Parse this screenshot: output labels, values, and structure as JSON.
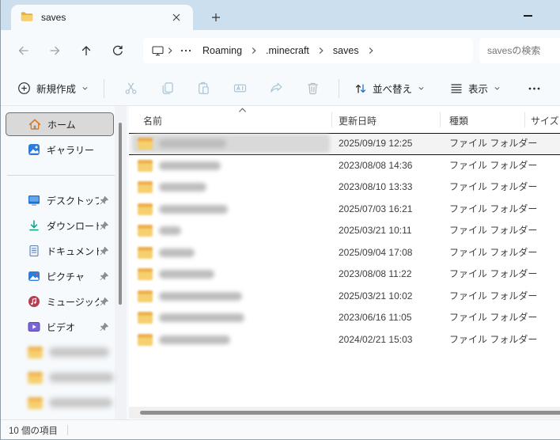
{
  "titlebar": {
    "tab_title": "saves"
  },
  "address": {
    "crumbs": [
      "Roaming",
      ".minecraft",
      "saves"
    ],
    "device_icon": "this-pc-icon"
  },
  "search": {
    "placeholder": "savesの検索"
  },
  "toolbar": {
    "new_label": "新規作成",
    "sort_label": "並べ替え",
    "view_label": "表示",
    "disabled_icons": [
      "cut",
      "copy",
      "paste",
      "rename",
      "share",
      "delete"
    ]
  },
  "sidebar": {
    "items": [
      {
        "label": "ホーム",
        "icon": "home",
        "selected": true,
        "pinned": false
      },
      {
        "label": "ギャラリー",
        "icon": "gallery",
        "selected": false,
        "pinned": false
      },
      {
        "divider": true
      },
      {
        "label": "デスクトップ",
        "icon": "desktop",
        "selected": false,
        "pinned": true
      },
      {
        "label": "ダウンロード",
        "icon": "downloads",
        "selected": false,
        "pinned": true
      },
      {
        "label": "ドキュメント",
        "icon": "documents",
        "selected": false,
        "pinned": true
      },
      {
        "label": "ピクチャ",
        "icon": "pictures",
        "selected": false,
        "pinned": true
      },
      {
        "label": "ミュージック",
        "icon": "music",
        "selected": false,
        "pinned": true
      },
      {
        "label": "ビデオ",
        "icon": "videos",
        "selected": false,
        "pinned": true
      },
      {
        "blurred": true,
        "blur_width": 76
      },
      {
        "blurred": true,
        "blur_width": 86
      },
      {
        "blurred": true,
        "blur_width": 80
      }
    ]
  },
  "list": {
    "columns": [
      "名前",
      "更新日時",
      "種類",
      "サイズ"
    ],
    "sort": {
      "column": "名前",
      "direction": "asc"
    },
    "rows": [
      {
        "name_blurred": true,
        "blur_width": 85,
        "date": "2025/09/19 12:25",
        "type": "ファイル フォルダー",
        "selected": true
      },
      {
        "name_blurred": true,
        "blur_width": 78,
        "date": "2023/08/08 14:36",
        "type": "ファイル フォルダー",
        "selected": false
      },
      {
        "name_blurred": true,
        "blur_width": 60,
        "date": "2023/08/10 13:33",
        "type": "ファイル フォルダー",
        "selected": false
      },
      {
        "name_blurred": true,
        "blur_width": 87,
        "date": "2025/07/03 16:21",
        "type": "ファイル フォルダー",
        "selected": false
      },
      {
        "name_blurred": true,
        "blur_width": 28,
        "date": "2025/03/21 10:11",
        "type": "ファイル フォルダー",
        "selected": false
      },
      {
        "name_blurred": true,
        "blur_width": 45,
        "date": "2025/09/04 17:08",
        "type": "ファイル フォルダー",
        "selected": false
      },
      {
        "name_blurred": true,
        "blur_width": 70,
        "date": "2023/08/08 11:22",
        "type": "ファイル フォルダー",
        "selected": false
      },
      {
        "name_blurred": true,
        "blur_width": 105,
        "date": "2025/03/21 10:02",
        "type": "ファイル フォルダー",
        "selected": false
      },
      {
        "name_blurred": true,
        "blur_width": 108,
        "date": "2023/06/16 11:05",
        "type": "ファイル フォルダー",
        "selected": false
      },
      {
        "name_blurred": true,
        "blur_width": 90,
        "date": "2024/02/21 15:03",
        "type": "ファイル フォルダー",
        "selected": false
      }
    ]
  },
  "statusbar": {
    "items_count": "10 個の項目"
  },
  "colors": {
    "titlebar_bg": "#cbdfee",
    "chrome_bg": "#f6fafd",
    "folder_yellow": "#f6cf6e",
    "folder_dark": "#eead49",
    "accent_blue": "#1f6fd0",
    "disabled_icon": "#abc4d5",
    "selection_border": "#141414"
  }
}
